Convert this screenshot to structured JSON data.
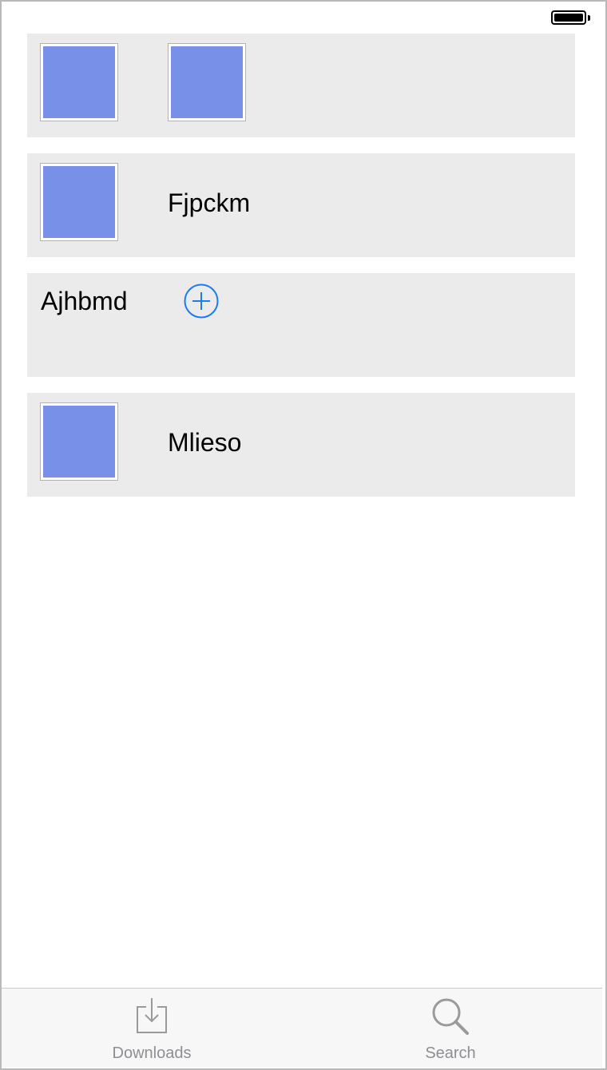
{
  "status_bar": {
    "battery_icon": "battery-full-icon"
  },
  "list": [
    {
      "type": "images",
      "thumbnails": 2
    },
    {
      "type": "image-label",
      "label": "Fjpckm"
    },
    {
      "type": "label-add",
      "label": "Ajhbmd",
      "add_icon": "plus-circle-icon"
    },
    {
      "type": "image-label",
      "label": "Mlieso"
    }
  ],
  "tab_bar": {
    "tabs": [
      {
        "label": "Downloads",
        "icon": "download-icon"
      },
      {
        "label": "Search",
        "icon": "search-icon"
      }
    ]
  },
  "colors": {
    "card_background": "#ebebeb",
    "thumbnail": "#7890e8",
    "accent_blue": "#1a7cf0",
    "tab_inactive": "#8e8e93"
  }
}
